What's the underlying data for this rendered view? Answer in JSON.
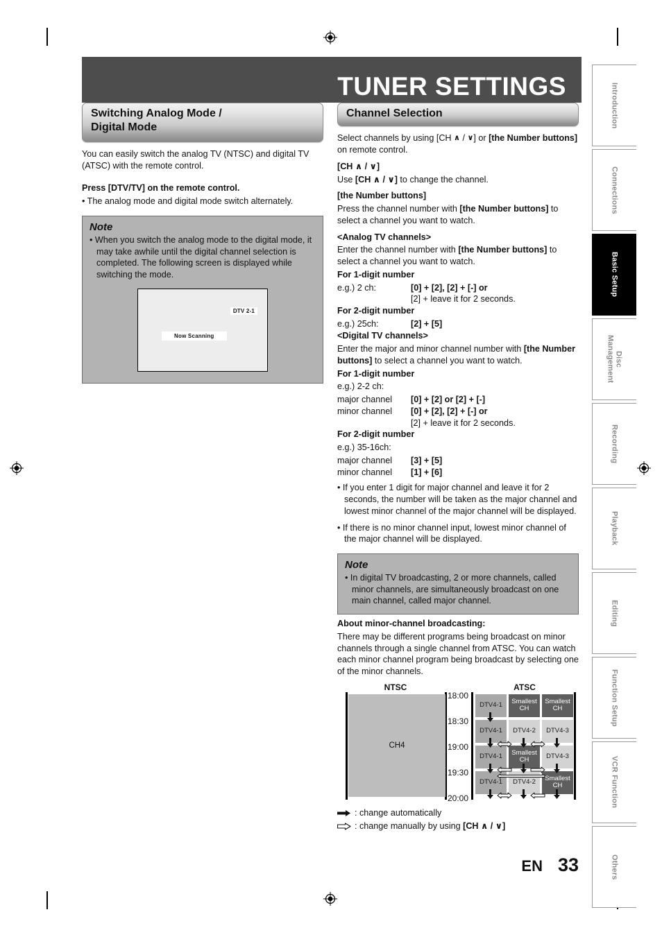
{
  "page": {
    "title": "TUNER SETTINGS",
    "footer_lang": "EN",
    "footer_page": "33"
  },
  "left_column": {
    "section_title_line1": "Switching Analog Mode /",
    "section_title_line2": "Digital Mode",
    "intro": "You can easily switch the analog TV (NTSC) and digital TV (ATSC) with the remote control.",
    "press_heading": "Press [DTV/TV] on the remote control.",
    "press_bullet": "• The analog mode and digital mode switch alternately.",
    "note": {
      "title": "Note",
      "bullet": "• When you switch the analog mode to the digital mode, it may take awhile until the digital channel selection is completed. The following screen is displayed while switching the mode."
    },
    "tv_screen": {
      "channel_label": "DTV 2-1",
      "status_label": "Now Scanning"
    }
  },
  "right_column": {
    "section_title": "Channel Selection",
    "intro_a": "Select channels by using [CH ",
    "intro_b": " / ",
    "intro_c": "] or ",
    "intro_bold": "[the Number buttons]",
    "intro_end": " on remote control.",
    "ch_heading": "[CH ∧ / ∨]",
    "ch_text_pre": "Use ",
    "ch_text_bold": "[CH ∧ / ∨]",
    "ch_text_post": " to change the channel.",
    "numbuttons_heading": "[the Number buttons]",
    "numbuttons_text_1": "Press the channel number with ",
    "numbuttons_text_bold": "[the Number buttons]",
    "numbuttons_text_2": " to select a channel you want to watch.",
    "analog_heading": "<Analog TV channels>",
    "analog_text_1": "Enter the channel number with ",
    "analog_text_bold": "[the Number buttons]",
    "analog_text_2": " to select a channel you want to watch.",
    "analog_1digit_heading": "For 1-digit number",
    "analog_1digit_label": "e.g.) 2 ch:",
    "analog_1digit_value_1": "[0] + [2], [2] + [-] or",
    "analog_1digit_value_2": "[2] + leave it for 2 seconds.",
    "analog_2digit_heading": "For 2-digit number",
    "analog_2digit_label": "e.g.) 25ch:",
    "analog_2digit_value": "[2] + [5]",
    "digital_heading": "<Digital TV channels>",
    "digital_text_1": "Enter the major and minor channel number with ",
    "digital_text_bold": "[the Number buttons]",
    "digital_text_2": " to select a channel you want to watch.",
    "digital_1digit_heading": "For 1-digit number",
    "digital_1digit_label": "e.g.) 2-2 ch:",
    "digital_1digit_major_label": "major channel",
    "digital_1digit_major_value": "[0] + [2] or [2] + [-]",
    "digital_1digit_minor_label": "minor channel",
    "digital_1digit_minor_value_1": "[0] + [2], [2] + [-] or",
    "digital_1digit_minor_value_2": "[2] + leave it for 2 seconds.",
    "digital_2digit_heading": "For 2-digit number",
    "digital_2digit_label": "e.g.) 35-16ch:",
    "digital_2digit_major_label": "major channel",
    "digital_2digit_major_value": "[3] + [5]",
    "digital_2digit_minor_label": "minor channel",
    "digital_2digit_minor_value": "[1] + [6]",
    "bullet_1": "• If you enter 1 digit for major channel and leave it for 2 seconds, the number will be taken as the major channel and lowest minor channel of the major channel will be displayed.",
    "bullet_2": "• If there is no minor channel input, lowest minor channel of the major channel will be displayed.",
    "note": {
      "title": "Note",
      "bullet": "• In digital TV broadcasting, 2 or more channels, called minor channels, are simultaneously broadcast on one main channel, called major channel."
    },
    "about_heading": "About minor-channel broadcasting:",
    "about_text": "There may be different programs being broadcast on minor channels through a single channel from ATSC. You can watch each minor channel program being broadcast by selecting one of the minor channels.",
    "legend_auto": ": change automatically",
    "legend_manual_pre": ": change manually by using ",
    "legend_manual_bold": "[CH ∧ / ∨]"
  },
  "chart_data": {
    "type": "table",
    "title": "Minor-channel broadcasting timeline",
    "columns": [
      "NTSC",
      "ATSC"
    ],
    "ntsc_label": "NTSC",
    "atsc_label": "ATSC",
    "ntsc_channel": "CH4",
    "time_ticks": [
      "18:00",
      "18:30",
      "19:00",
      "19:30",
      "20:00"
    ],
    "atsc_columns": [
      "DTV4-1",
      "DTV4-2",
      "DTV4-3"
    ],
    "rows": [
      {
        "time_start": "18:00",
        "time_end": "18:30",
        "cells": [
          {
            "label": "DTV4-1",
            "shade": "med"
          },
          {
            "label": "Smallest CH",
            "shade": "dark"
          },
          {
            "label": "Smallest CH",
            "shade": "dark"
          }
        ]
      },
      {
        "time_start": "18:30",
        "time_end": "19:00",
        "cells": [
          {
            "label": "DTV4-1",
            "shade": "med"
          },
          {
            "label": "DTV4-2",
            "shade": "light"
          },
          {
            "label": "DTV4-3",
            "shade": "light"
          }
        ]
      },
      {
        "time_start": "19:00",
        "time_end": "19:30",
        "cells": [
          {
            "label": "DTV4-1",
            "shade": "med"
          },
          {
            "label": "Smallest CH",
            "shade": "dark"
          },
          {
            "label": "DTV4-3",
            "shade": "light"
          }
        ]
      },
      {
        "time_start": "19:30",
        "time_end": "20:00",
        "cells": [
          {
            "label": "DTV4-1",
            "shade": "med"
          },
          {
            "label": "DTV4-2",
            "shade": "light"
          },
          {
            "label": "Smallest CH",
            "shade": "dark"
          }
        ]
      }
    ],
    "legend": [
      {
        "marker": "solid-arrow",
        "text": "change automatically"
      },
      {
        "marker": "outline-arrow",
        "text": "change manually by using [CH ∧ / ∨]"
      }
    ]
  },
  "side_tabs": [
    {
      "label": "Introduction",
      "active": false
    },
    {
      "label": "Connections",
      "active": false
    },
    {
      "label": "Basic Setup",
      "active": true
    },
    {
      "label": "Disc\nManagement",
      "active": false
    },
    {
      "label": "Recording",
      "active": false
    },
    {
      "label": "Playback",
      "active": false
    },
    {
      "label": "Editing",
      "active": false
    },
    {
      "label": "Function Setup",
      "active": false
    },
    {
      "label": "VCR Function",
      "active": false
    },
    {
      "label": "Others",
      "active": false
    }
  ]
}
